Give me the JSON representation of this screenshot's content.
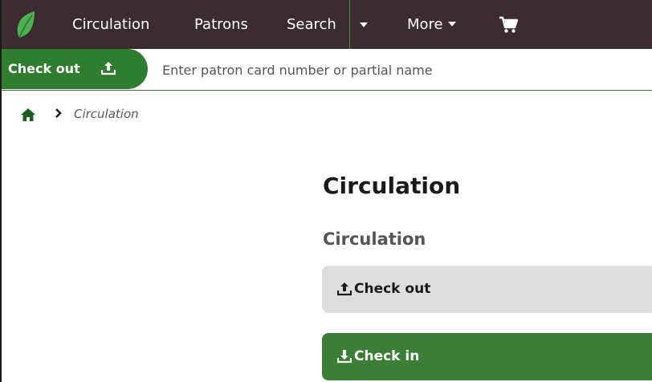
{
  "navbar": {
    "logo_icon": "koha-leaf-icon",
    "items": [
      {
        "label": "Circulation"
      },
      {
        "label": "Patrons"
      },
      {
        "label": "Search"
      },
      {
        "label": "More"
      }
    ],
    "cart_icon": "cart-icon",
    "background": "#3a2c31",
    "accent": "#4a8f3a"
  },
  "searchbar": {
    "tab_label": "Check out",
    "tab_icon": "upload-icon",
    "placeholder": "Enter patron card number or partial name",
    "value": "",
    "accent": "#2f7d2f"
  },
  "breadcrumb": {
    "home_icon": "home-icon",
    "separator_icon": "chevron-right-icon",
    "current": "Circulation"
  },
  "main": {
    "title": "Circulation",
    "section_title": "Circulation",
    "buttons": [
      {
        "label": "Check out",
        "icon": "upload-icon",
        "background": "#dedede"
      },
      {
        "label": "Check in",
        "icon": "download-icon",
        "background": "#3a7f35"
      }
    ]
  }
}
